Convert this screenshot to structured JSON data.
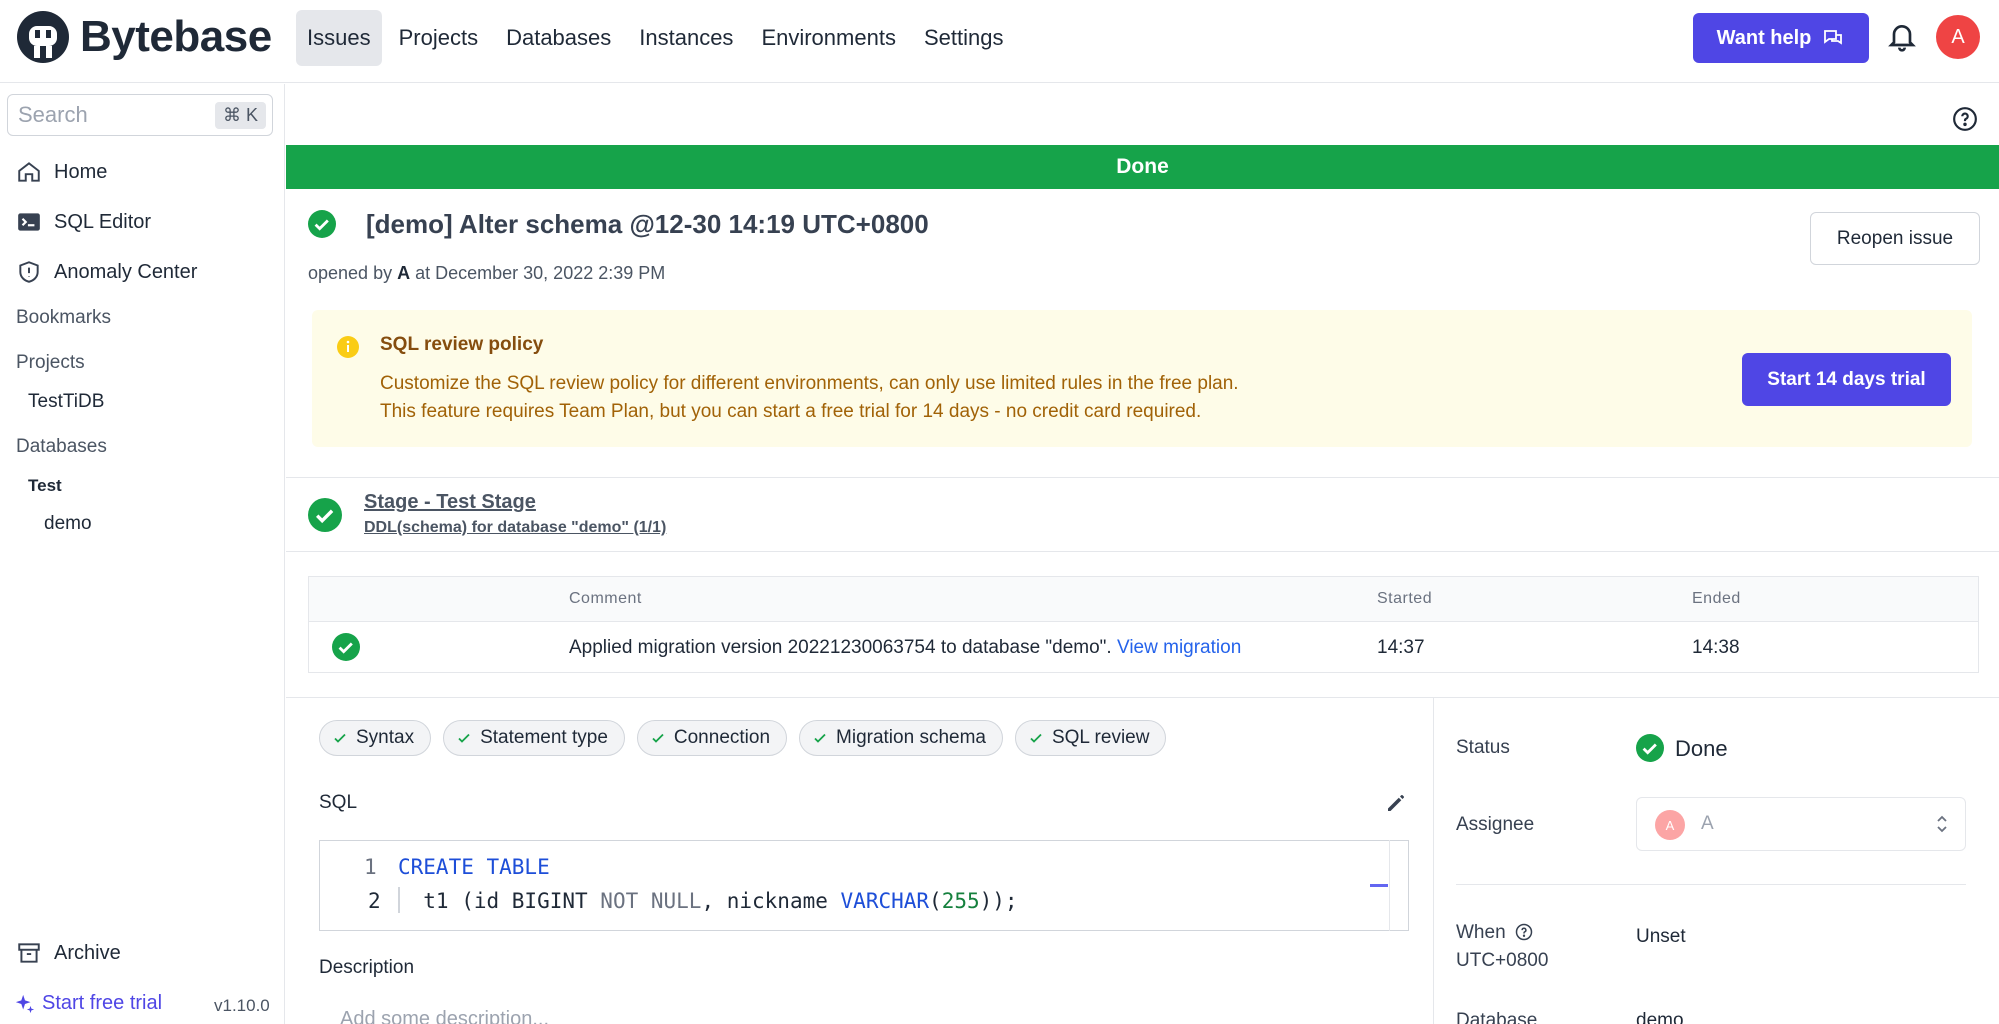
{
  "brand": {
    "name": "Bytebase"
  },
  "nav": {
    "items": [
      {
        "label": "Issues",
        "active": true
      },
      {
        "label": "Projects"
      },
      {
        "label": "Databases"
      },
      {
        "label": "Instances"
      },
      {
        "label": "Environments"
      },
      {
        "label": "Settings"
      }
    ],
    "help_label": "Want help",
    "avatar": "A"
  },
  "sidebar": {
    "search_placeholder": "Search",
    "search_shortcut": "⌘ K",
    "home": "Home",
    "sql_editor": "SQL Editor",
    "anomaly_center": "Anomaly Center",
    "bookmarks": "Bookmarks",
    "projects_header": "Projects",
    "project_item": "TestTiDB",
    "databases_header": "Databases",
    "env_item": "Test",
    "db_item": "demo",
    "archive": "Archive",
    "trial": "Start free trial",
    "version": "v1.10.0"
  },
  "issue": {
    "banner": "Done",
    "title": "[demo] Alter schema @12-30 14:19 UTC+0800",
    "opened_prefix": "opened by",
    "opened_user": "A",
    "opened_suffix": "at December 30, 2022 2:39 PM",
    "reopen": "Reopen issue"
  },
  "policy": {
    "title": "SQL review policy",
    "line1": "Customize the SQL review policy for different environments, can only use limited rules in the free plan.",
    "line2": "This feature requires Team Plan, but you can start a free trial for 14 days - no credit card required.",
    "button": "Start 14 days trial"
  },
  "stage": {
    "title": "Stage - Test Stage",
    "subtitle": "DDL(schema) for database \"demo\" (1/1)"
  },
  "task_table": {
    "headers": [
      "Comment",
      "Started",
      "Ended"
    ],
    "rows": [
      {
        "comment": "Applied migration version 20221230063754 to database \"demo\".",
        "link": "View migration",
        "started": "14:37",
        "ended": "14:38"
      }
    ]
  },
  "checks": [
    "Syntax",
    "Statement type",
    "Connection",
    "Migration schema",
    "SQL review"
  ],
  "sql": {
    "label": "SQL",
    "lines": [
      {
        "n": "1",
        "parts": [
          [
            "kw",
            "CREATE TABLE"
          ]
        ]
      },
      {
        "n": "2",
        "parts": [
          [
            "",
            "  t1 (id BIGINT "
          ],
          [
            "kw2",
            "NOT NULL"
          ],
          [
            "",
            ", nickname "
          ],
          [
            "kw",
            "VARCHAR"
          ],
          [
            "",
            "("
          ],
          [
            "num",
            "255"
          ],
          [
            "",
            "));"
          ]
        ]
      }
    ]
  },
  "description": {
    "label": "Description",
    "placeholder": "Add some description..."
  },
  "meta": {
    "status_label": "Status",
    "status_value": "Done",
    "assignee_label": "Assignee",
    "assignee_avatar": "A",
    "assignee_name": "A",
    "when_label": "When",
    "when_tz": "UTC+0800",
    "when_value": "Unset",
    "database_label": "Database",
    "database_value": "demo"
  },
  "colors": {
    "accent": "#4f46e5",
    "success": "#16a34a",
    "warning_bg": "#fefce8"
  }
}
